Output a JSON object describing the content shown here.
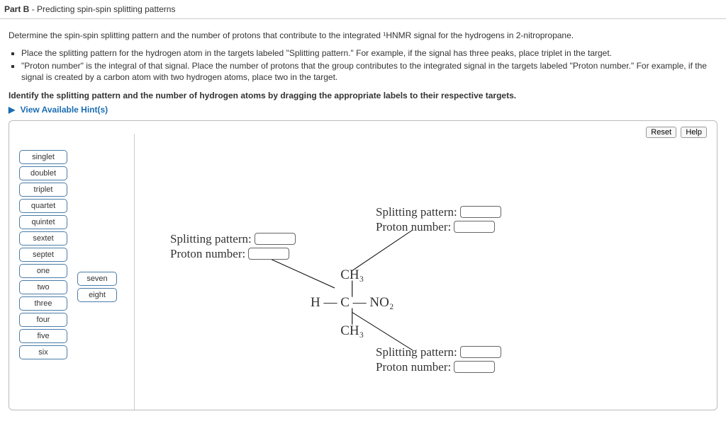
{
  "header": {
    "part": "Part B",
    "title": "Predicting spin-spin splitting patterns"
  },
  "intro": "Determine the spin-spin splitting pattern and the number of protons that contribute to the integrated ¹HNMR signal for the hydrogens in 2-nitropropane.",
  "bullets": [
    "Place the splitting pattern for the hydrogen atom in the targets labeled \"Splitting pattern.\" For example, if the signal has three peaks, place triplet in the target.",
    "\"Proton number\" is the integral of that signal.  Place the number of protons that the group contributes to the integrated signal in the targets labeled \"Proton number.\" For example, if the signal is created by a carbon atom with two hydrogen atoms, place two in the target."
  ],
  "directive": "Identify the splitting pattern and the number of hydrogen atoms by dragging the appropriate labels to their respective targets.",
  "hints": "View Available Hint(s)",
  "toolbar": {
    "reset": "Reset",
    "help": "Help"
  },
  "tags_col1": [
    "singlet",
    "doublet",
    "triplet",
    "quartet",
    "quintet",
    "sextet",
    "septet",
    "one",
    "two",
    "three",
    "four",
    "five",
    "six"
  ],
  "tags_col2": [
    "seven",
    "eight"
  ],
  "group_labels": {
    "sp": "Splitting pattern:",
    "pn": "Proton number:"
  },
  "structure": {
    "l1": "CH₃",
    "l2": "│",
    "l3": "H — C — NO₂",
    "l4": "│",
    "l5": "CH₃"
  }
}
